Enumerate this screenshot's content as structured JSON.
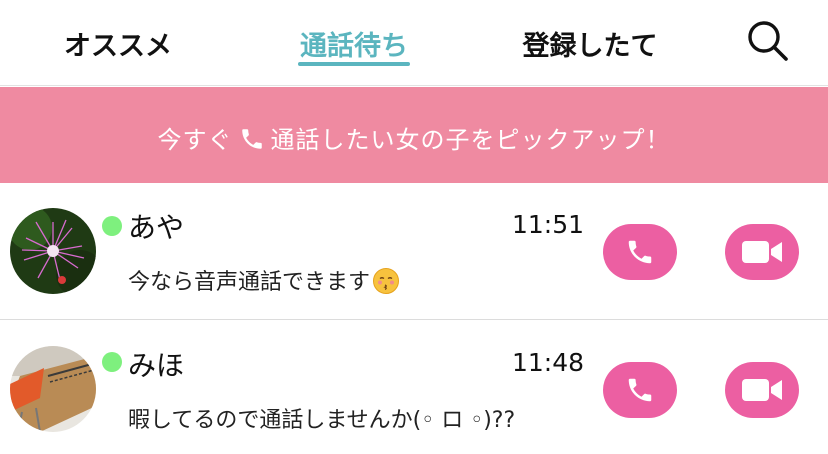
{
  "tabs": [
    {
      "label": "オススメ",
      "active": false
    },
    {
      "label": "通話待ち",
      "active": true
    },
    {
      "label": "登録したて",
      "active": false
    }
  ],
  "colors": {
    "accent": "#5bb5bf",
    "banner": "#ef8aa1",
    "call_button": "#ec5fa2",
    "online": "#7ef07e"
  },
  "banner": {
    "text_before": "今すぐ",
    "icon": "phone-icon",
    "text_after": "通話したい女の子をピックアップ！"
  },
  "users": [
    {
      "name": "あや",
      "time": "11:51",
      "message": "今なら音声通話できます",
      "emoji": "kissing-face-icon",
      "online": true
    },
    {
      "name": "みほ",
      "time": "11:48",
      "message": "暇してるので通話しませんか(◦ ロ ◦)??",
      "online": true
    }
  ],
  "icons": {
    "search": "search-icon",
    "voice_call": "phone-icon",
    "video_call": "video-camera-icon"
  }
}
